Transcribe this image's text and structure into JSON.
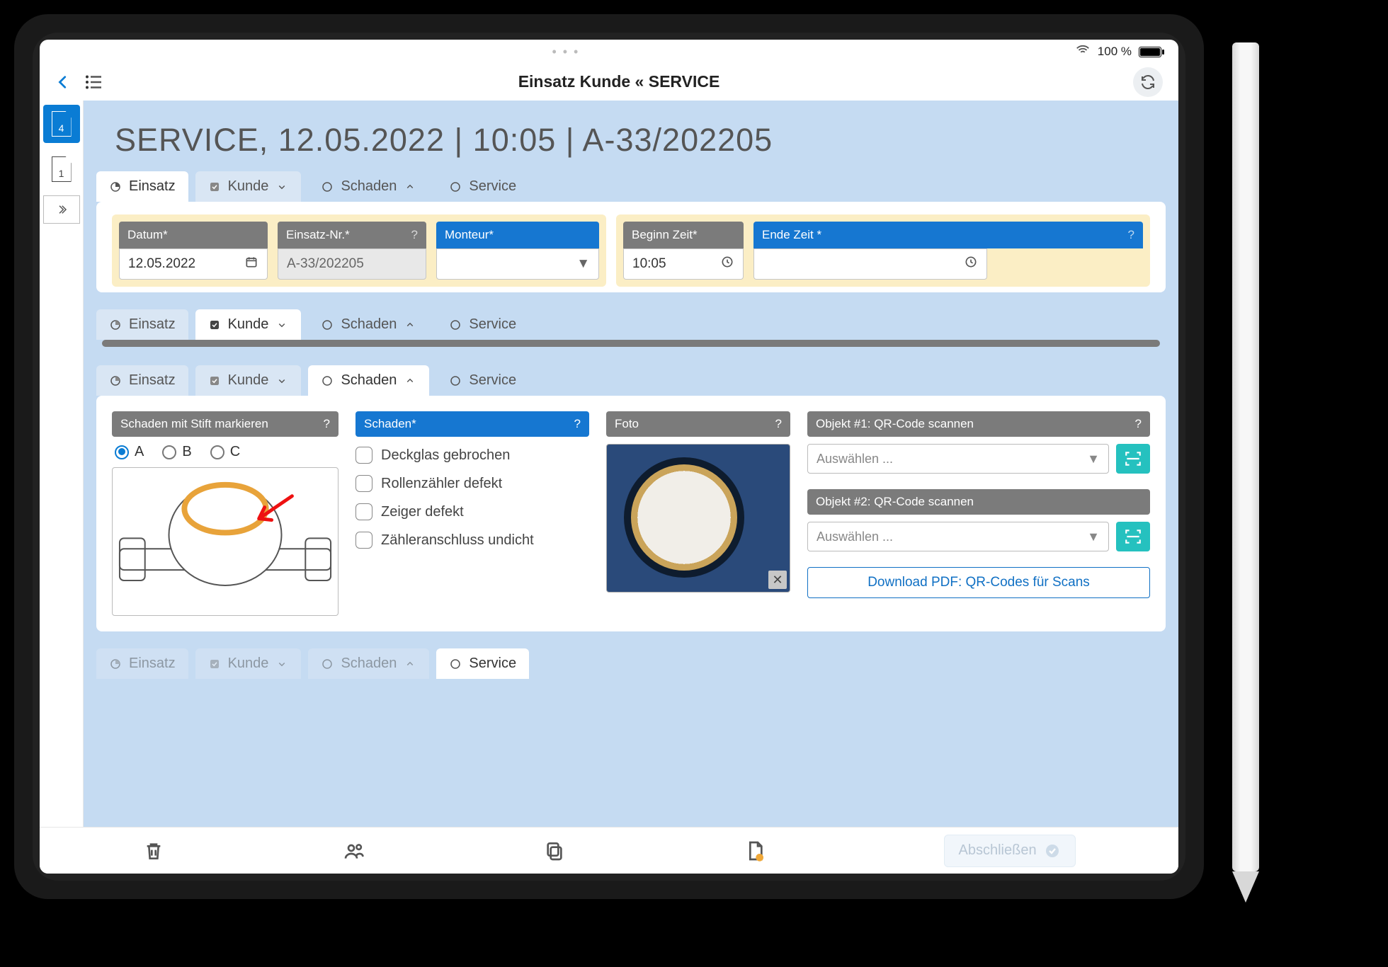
{
  "status": {
    "battery_pct": "100 %"
  },
  "nav": {
    "title": "Einsatz Kunde « SERVICE"
  },
  "rail": {
    "active_badge": "4",
    "second_badge": "1"
  },
  "title": "SERVICE,  12.05.2022 | 10:05 | A-33/202205",
  "tabs": {
    "einsatz": "Einsatz",
    "kunde": "Kunde",
    "schaden": "Schaden",
    "service": "Service"
  },
  "einsatz": {
    "datum_label": "Datum*",
    "datum_value": "12.05.2022",
    "nr_label": "Einsatz-Nr.*",
    "nr_value": "A-33/202205",
    "monteur_label": "Monteur*",
    "monteur_value": "",
    "beginn_label": "Beginn Zeit*",
    "beginn_value": "10:05",
    "ende_label": "Ende Zeit *",
    "ende_value": ""
  },
  "schaden": {
    "marker_label": "Schaden mit Stift markieren",
    "opt_a": "A",
    "opt_b": "B",
    "opt_c": "C",
    "list_label": "Schaden*",
    "items": [
      "Deckglas gebrochen",
      "Rollenzähler defekt",
      "Zeiger defekt",
      "Zähleranschluss undicht"
    ],
    "foto_label": "Foto",
    "qr1_label": "Objekt #1: QR-Code scannen",
    "qr2_label": "Objekt #2: QR-Code scannen",
    "select_placeholder": "Auswählen ...",
    "download_label": "Download PDF: QR-Codes für Scans"
  },
  "footer": {
    "finish": "Abschließen"
  }
}
